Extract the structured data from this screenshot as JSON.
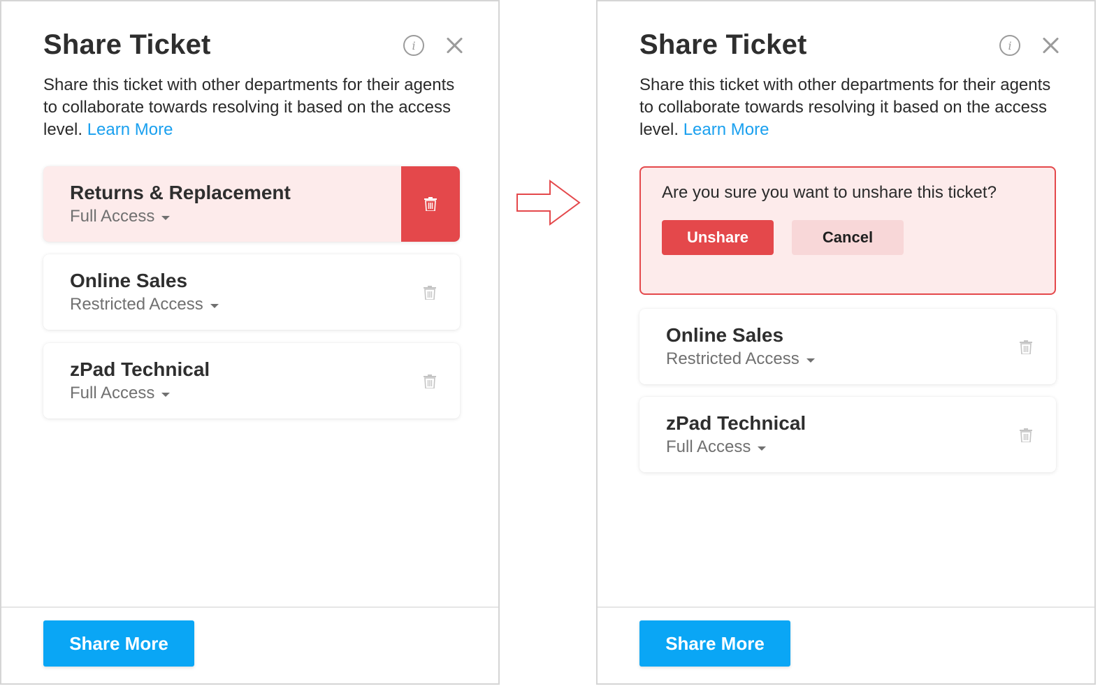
{
  "colors": {
    "accent": "#0aa6f5",
    "link": "#1aa0ef",
    "danger": "#e4484b",
    "danger_bg": "#fdebeb",
    "cancel_bg": "#f8d7d8"
  },
  "left_panel": {
    "title": "Share Ticket",
    "description": "Share this ticket with other departments for their agents to collaborate towards resolving it based on the access level.",
    "learn_more": "Learn More",
    "shares": [
      {
        "name": "Returns & Replacement",
        "access": "Full Access",
        "state": "delete-hover"
      },
      {
        "name": "Online Sales",
        "access": "Restricted Access"
      },
      {
        "name": "zPad Technical",
        "access": "Full Access"
      }
    ],
    "share_more_label": "Share More"
  },
  "right_panel": {
    "title": "Share Ticket",
    "description": "Share this ticket with other departments for their agents to collaborate towards resolving it based on the access level.",
    "learn_more": "Learn More",
    "confirm": {
      "question": "Are you sure you want to unshare this ticket?",
      "unshare_label": "Unshare",
      "cancel_label": "Cancel"
    },
    "shares": [
      {
        "name": "Online Sales",
        "access": "Restricted Access"
      },
      {
        "name": "zPad Technical",
        "access": "Full Access"
      }
    ],
    "share_more_label": "Share More"
  },
  "icons": {
    "info": "info-icon",
    "close": "close-icon",
    "trash": "trash-icon",
    "caret": "caret-down-icon",
    "transition_arrow": "arrow-right-icon"
  }
}
